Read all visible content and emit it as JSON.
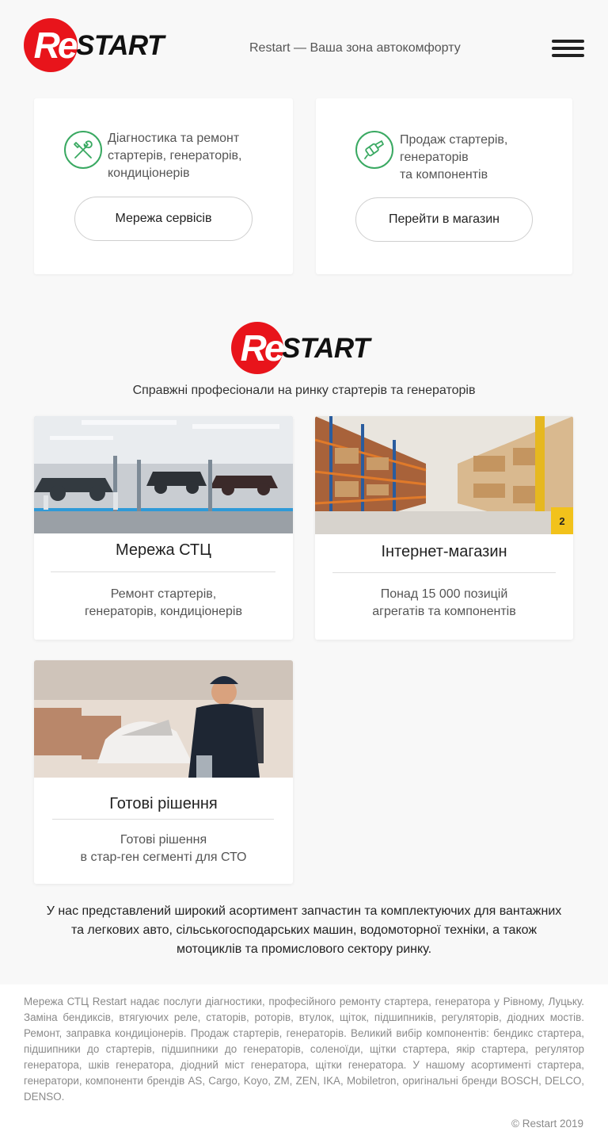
{
  "header": {
    "logo": {
      "re": "Re",
      "start": "START"
    },
    "tagline": "Restart — Ваша зона автокомфорту",
    "menu_icon": "hamburger-icon"
  },
  "services": [
    {
      "icon": "wrench-screwdriver-icon",
      "lines": [
        "Діагностика та ремонт",
        "стартерів, генераторів,",
        "кондиціонерів"
      ],
      "button": "Мережа сервісів"
    },
    {
      "icon": "starter-motor-icon",
      "lines": [
        "Продаж стартерів,",
        "генераторів",
        "та компонентів"
      ],
      "button": "Перейти в магазин"
    }
  ],
  "mid": {
    "logo": {
      "re": "Re",
      "start": "START"
    },
    "subtitle": "Справжні професіонали на ринку стартерів та генераторів"
  },
  "tiles": [
    {
      "title": "Мережа СТЦ",
      "lines": [
        "Ремонт стартерів,",
        "генераторів, кондиціонерів"
      ]
    },
    {
      "title": "Інтернет-магазин",
      "lines": [
        "Понад 15 000 позицій",
        "агрегатів та компонентів"
      ],
      "badge": "2"
    },
    {
      "title": "Готові рішення",
      "lines": [
        "Готові рішення",
        "в стар-ген сегменті для СТО"
      ]
    }
  ],
  "about": {
    "lines": [
      "У нас представлений широкий асортимент запчастин та комплектуючих для вантажних",
      "та легкових авто, сільськогосподарських машин, водомоторної техніки, а також",
      "мотоциклів та промислового сектору ринку."
    ]
  },
  "footer": {
    "legal": "Мережа СТЦ Restart надає послуги діагностики, професійного ремонту стартера, генератора у Рівному, Луцьку. Заміна бендиксів, втягуючих реле, статорів, роторів, втулок, щіток, підшипників, регуляторів, діодних мостів. Ремонт, заправка кондиціонерів. Продаж стартерів, генераторів. Великий вибір компонентів: бендикс стартера, підшипники до стартерів, підшипники до генераторів, соленоїди, щітки стартера, якір стартера, регулятор генератора, шків генератора, діодний міст генератора, щітки генератора. У нашому асортименті стартера, генератори, компоненти брендів AS, Cargo, Koyo, ZM, ZEN, IKA, Mobiletron, оригінальні бренди BOSCH, DELCO, DENSO.",
    "copyright": "© Restart 2019"
  },
  "colors": {
    "brand_red": "#e8141b",
    "icon_green": "#3aa962",
    "badge_yellow": "#f2c21b"
  }
}
